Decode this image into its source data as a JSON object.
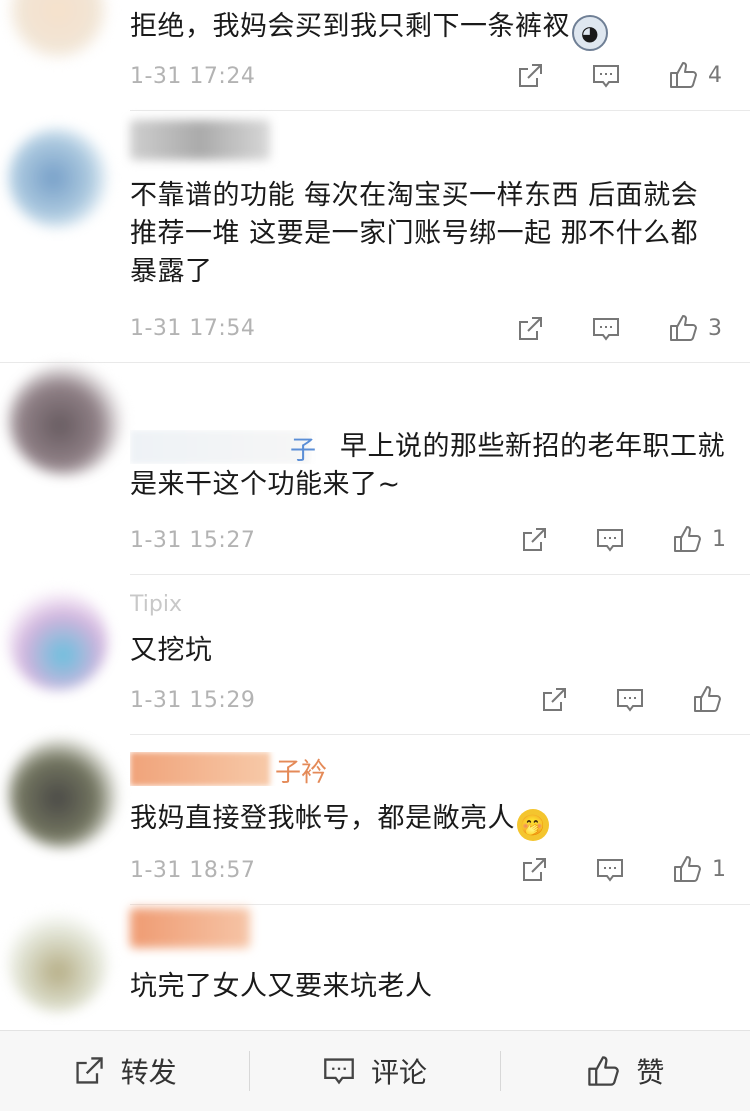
{
  "comments": [
    {
      "text": "拒绝，我妈会买到我只剩下一条裤衩",
      "emoji": "husky-emoji",
      "time": "1-31 17:24",
      "likes": "4",
      "avatar_color": "#f2d2b6"
    },
    {
      "text": "不靠谱的功能 每次在淘宝买一样东西 后面就会推荐一堆 这要是一家门账号绑一起 那不什么都暴露了",
      "time": "1-31 17:54",
      "likes": "3",
      "avatar_color": "#7ea6cc"
    },
    {
      "name_visible": "子",
      "text": "早上说的那些新招的老年职工就是来干这个功能来了~",
      "time": "1-31 15:27",
      "likes": "1",
      "avatar_color": "#5b4a52"
    },
    {
      "name_visible": "Tipix",
      "text": "又挖坑",
      "time": "1-31 15:29",
      "likes": "",
      "avatar_color": "#c9a6d8"
    },
    {
      "name_visible": "子衿",
      "text": "我妈直接登我帐号，都是敞亮人",
      "emoji": "hmm-emoji",
      "time": "1-31 18:57",
      "likes": "1",
      "avatar_color": "#3a3a32"
    },
    {
      "text": "坑完了女人又要来坑老人",
      "avatar_color": "#d9dcc6"
    }
  ],
  "bottom_bar": {
    "repost": "转发",
    "comment": "评论",
    "like": "赞"
  }
}
